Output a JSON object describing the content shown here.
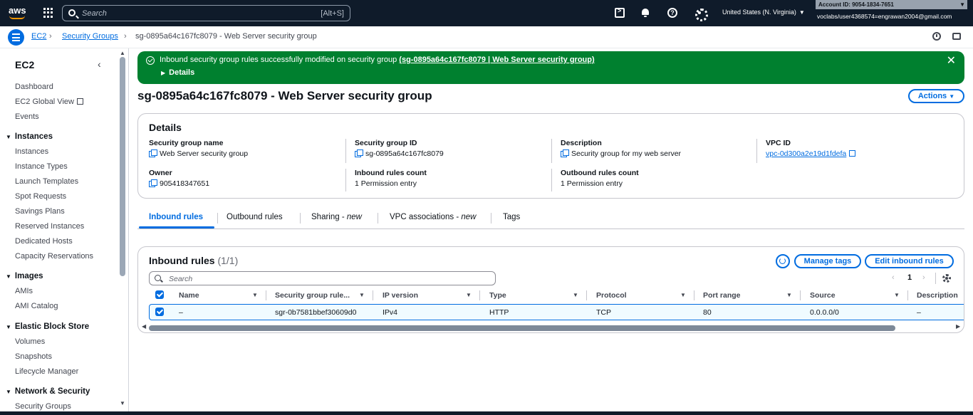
{
  "topbar": {
    "logo": "aws",
    "search_placeholder": "Search",
    "search_shortcut": "[Alt+S]",
    "region": "United States (N. Virginia)",
    "account": "Account ID: 9054-1834-7651",
    "user": "voclabs/user4368574=engrawan2004@gmail.com"
  },
  "breadcrumb": {
    "root": "EC2",
    "parent": "Security Groups",
    "current": "sg-0895a64c167fc8079 - Web Server security group"
  },
  "sidebar": {
    "title": "EC2",
    "top_items": [
      "Dashboard",
      "EC2 Global View",
      "Events"
    ],
    "sections": [
      {
        "heading": "Instances",
        "items": [
          "Instances",
          "Instance Types",
          "Launch Templates",
          "Spot Requests",
          "Savings Plans",
          "Reserved Instances",
          "Dedicated Hosts",
          "Capacity Reservations"
        ]
      },
      {
        "heading": "Images",
        "items": [
          "AMIs",
          "AMI Catalog"
        ]
      },
      {
        "heading": "Elastic Block Store",
        "items": [
          "Volumes",
          "Snapshots",
          "Lifecycle Manager"
        ]
      },
      {
        "heading": "Network & Security",
        "items": [
          "Security Groups"
        ]
      }
    ]
  },
  "flash": {
    "message": "Inbound security group rules successfully modified on security group",
    "link": "(sg-0895a64c167fc8079 | Web Server security group)",
    "details": "Details"
  },
  "page": {
    "title": "sg-0895a64c167fc8079 - Web Server security group",
    "actions": "Actions"
  },
  "details": {
    "header": "Details",
    "fields": {
      "sg_name_label": "Security group name",
      "sg_name": "Web Server security group",
      "sg_id_label": "Security group ID",
      "sg_id": "sg-0895a64c167fc8079",
      "description_label": "Description",
      "description": "Security group for my web server",
      "vpc_label": "VPC ID",
      "vpc": "vpc-0d300a2e19d1fdefa",
      "owner_label": "Owner",
      "owner": "905418347651",
      "inbound_count_label": "Inbound rules count",
      "inbound_count": "1 Permission entry",
      "outbound_count_label": "Outbound rules count",
      "outbound_count": "1 Permission entry"
    }
  },
  "tabs": {
    "inbound": "Inbound rules",
    "outbound": "Outbound rules",
    "sharing": "Sharing - ",
    "sharing_new": "new",
    "vpc_assoc": "VPC associations - ",
    "vpc_assoc_new": "new",
    "tags": "Tags"
  },
  "rules": {
    "title": "Inbound rules",
    "count": "(1/1)",
    "manage_tags": "Manage tags",
    "edit": "Edit inbound rules",
    "search_placeholder": "Search",
    "page": "1",
    "columns": [
      "Name",
      "Security group rule...",
      "IP version",
      "Type",
      "Protocol",
      "Port range",
      "Source",
      "Description"
    ],
    "rows": [
      {
        "name": "–",
        "rule_id": "sgr-0b7581bbef30609d0",
        "ip_version": "IPv4",
        "type": "HTTP",
        "protocol": "TCP",
        "port_range": "80",
        "source": "0.0.0.0/0",
        "description": "–"
      }
    ]
  }
}
